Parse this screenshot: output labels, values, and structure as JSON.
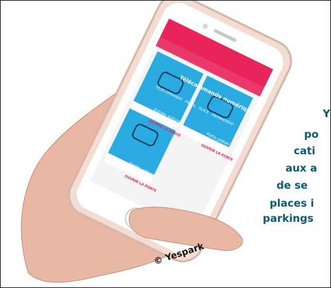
{
  "app": {
    "title": "Télécommande numérique",
    "tabs": [
      "TÉLÉCOMMANDE",
      "PROFIL",
      "PLACE",
      "ABONNEMENT"
    ],
    "cards": [
      {
        "label": "Entrée voiture",
        "link": "OUVRIR LA PORTE"
      },
      {
        "label": "Porte piéton",
        "link": "OUVRIR LA PORTE"
      },
      {
        "label": "Sortie voiture",
        "link": "OUVRIR LA PORTE"
      }
    ]
  },
  "overlay_lines": [
    "Y",
    "po",
    "cati",
    "aux a",
    "de se",
    "places i",
    "parkings"
  ],
  "credit": "© Yespark",
  "colors": {
    "accent": "#e8245a",
    "card": "#29abe2",
    "text": "#0d5b73"
  }
}
